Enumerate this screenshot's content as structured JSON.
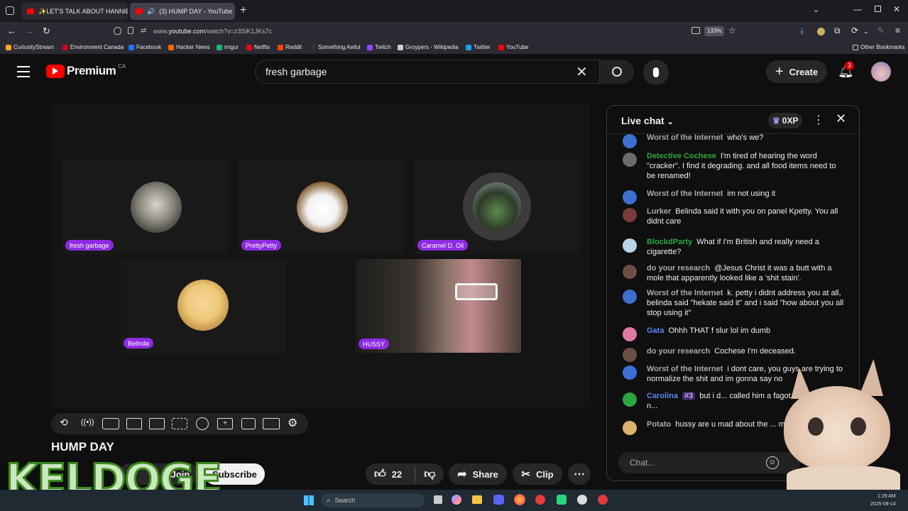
{
  "browser": {
    "tabs": [
      {
        "label": "✨LET'S TALK ABOUT HANNIBA",
        "active": false
      },
      {
        "label": "(3) HUMP DAY - YouTube",
        "active": true
      }
    ],
    "new_tab": "+",
    "url_prefix": "www.",
    "url_host": "youtube.com",
    "url_path": "/watch?v=z3SiK1JKs7c",
    "zoom": "133%",
    "bookmarks": [
      {
        "label": "CuriosityStream",
        "color": "#f5a623"
      },
      {
        "label": "Environment Canada",
        "color": "#d0021b"
      },
      {
        "label": "Facebook",
        "color": "#1877f2"
      },
      {
        "label": "Hacker News",
        "color": "#ff6600"
      },
      {
        "label": "imgur",
        "color": "#1bb76e"
      },
      {
        "label": "Netflix",
        "color": "#e50914"
      },
      {
        "label": "Reddit",
        "color": "#ff4500"
      },
      {
        "label": "Something Awful",
        "color": "#333333"
      },
      {
        "label": "Twitch",
        "color": "#9146ff"
      },
      {
        "label": "Groypers - Wikipedia",
        "color": "#cccccc"
      },
      {
        "label": "Twitter",
        "color": "#1da1f2"
      },
      {
        "label": "YouTube",
        "color": "#ff0000"
      }
    ],
    "other_bookmarks": "Other Bookmarks"
  },
  "youtube": {
    "logo_text": "Premium",
    "region": "CA",
    "search_value": "fresh garbage",
    "create_label": "Create",
    "notification_count": "3"
  },
  "video": {
    "participants": [
      {
        "name": "fresh garbage"
      },
      {
        "name": "PrettyPetty"
      },
      {
        "name": "Caramel D. Oil"
      },
      {
        "name": "Belinda"
      },
      {
        "name": "HUSSY"
      }
    ],
    "title": "HUMP DAY",
    "join_label": "Join",
    "subscribe_label": "Subscribe",
    "likes": "22",
    "share_label": "Share",
    "clip_label": "Clip"
  },
  "chat": {
    "title": "Live chat",
    "xp_label": "0XP",
    "messages": [
      {
        "author": "Worst of the Internet",
        "text": "who's we?",
        "author_color": "#aaaaaa"
      },
      {
        "author": "Detective Cochese",
        "text": "I'm tired of hearing the word \"cracker\". I find it degrading. and all food items need to be renamed!",
        "author_color": "#2ba640"
      },
      {
        "author": "Worst of the Internet",
        "text": "im not using it",
        "author_color": "#aaaaaa"
      },
      {
        "author": "Lurker",
        "text": "Belinda said it with you on panel Kpetty. You all didnt care",
        "author_color": "#aaaaaa"
      },
      {
        "author": "BlockdParty",
        "text": "What if I'm British and really need a cigarette?",
        "author_color": "#2ba640"
      },
      {
        "author": "do your research",
        "text": "@Jesus Christ it was a butt with a mole that apparently looked like a 'shit stain'.",
        "author_color": "#aaaaaa"
      },
      {
        "author": "Worst of the Internet",
        "text": "k. petty i didnt address you at all, belinda said \"hekate said it\" and i said \"how about you all stop using it\"",
        "author_color": "#aaaaaa"
      },
      {
        "author": "Gata",
        "text": "Ohhh THAT f slur lol im dumb",
        "author_color": "#5e84f1"
      },
      {
        "author": "do your research",
        "text": "Cochese I'm deceased.",
        "author_color": "#aaaaaa"
      },
      {
        "author": "Worst of the Internet",
        "text": "i dont care, you guys are trying to normalize the shit and im gonna say no",
        "author_color": "#aaaaaa"
      },
      {
        "author": "Carolina",
        "badge": "#3",
        "text": "but i d... called him a fagot. she said it but n...",
        "author_color": "#5e84f1"
      },
      {
        "author": "Potato",
        "text": "hussy are u mad about the ... mad",
        "author_color": "#aaaaaa"
      }
    ],
    "input_placeholder": "Chat..."
  },
  "taskbar": {
    "search_placeholder": "Search",
    "time": "1:29 AM",
    "date": "2025-08-14"
  },
  "overlay": {
    "watermark": "KELDOGE"
  }
}
